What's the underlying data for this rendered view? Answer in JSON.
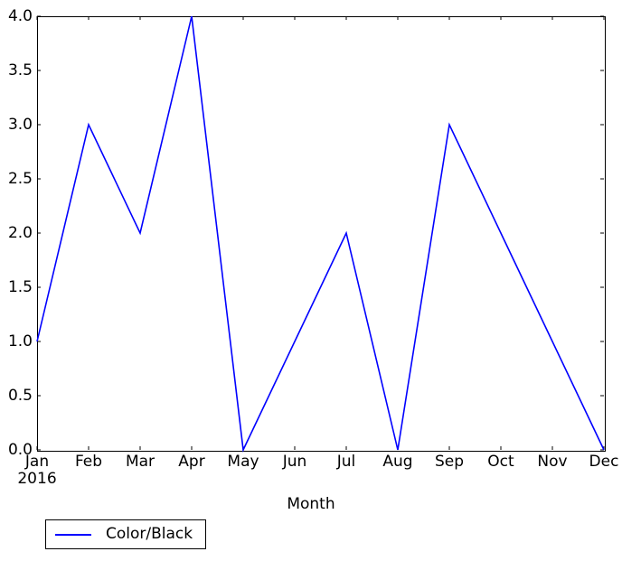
{
  "chart_data": {
    "type": "line",
    "title": "",
    "xlabel": "Month",
    "ylabel": "",
    "x": [
      "Jan",
      "Feb",
      "Mar",
      "Apr",
      "May",
      "Jun",
      "Jul",
      "Aug",
      "Sep",
      "Oct",
      "Nov",
      "Dec"
    ],
    "categories": [
      "Jan",
      "Feb",
      "Mar",
      "Apr",
      "May",
      "Jun",
      "Jul",
      "Aug",
      "Sep",
      "Oct",
      "Nov",
      "Dec"
    ],
    "x_sublabel": "2016",
    "x_sublabel_at": "Jan",
    "series": [
      {
        "name": "Color/Black",
        "color": "#0000ff",
        "values": [
          1.0,
          3.0,
          2.0,
          4.0,
          0.0,
          1.0,
          2.0,
          0.0,
          3.0,
          2.0,
          1.0,
          0.0
        ]
      }
    ],
    "ylim": [
      0.0,
      4.0
    ],
    "ytick_labels": [
      "0.0",
      "0.5",
      "1.0",
      "1.5",
      "2.0",
      "2.5",
      "3.0",
      "3.5",
      "4.0"
    ],
    "ytick_values": [
      0.0,
      0.5,
      1.0,
      1.5,
      2.0,
      2.5,
      3.0,
      3.5,
      4.0
    ],
    "xtick_labels": [
      "Jan",
      "Feb",
      "Mar",
      "Apr",
      "May",
      "Jun",
      "Jul",
      "Aug",
      "Sep",
      "Oct",
      "Nov",
      "Dec"
    ],
    "grid": false,
    "legend_position": "below-left",
    "legend_entries": [
      {
        "label": "Color/Black",
        "color": "#0000ff"
      }
    ]
  },
  "axes": {
    "xlabel": "Month",
    "ylabel": ""
  },
  "legend": {
    "entries": [
      {
        "label": "Color/Black"
      }
    ]
  }
}
